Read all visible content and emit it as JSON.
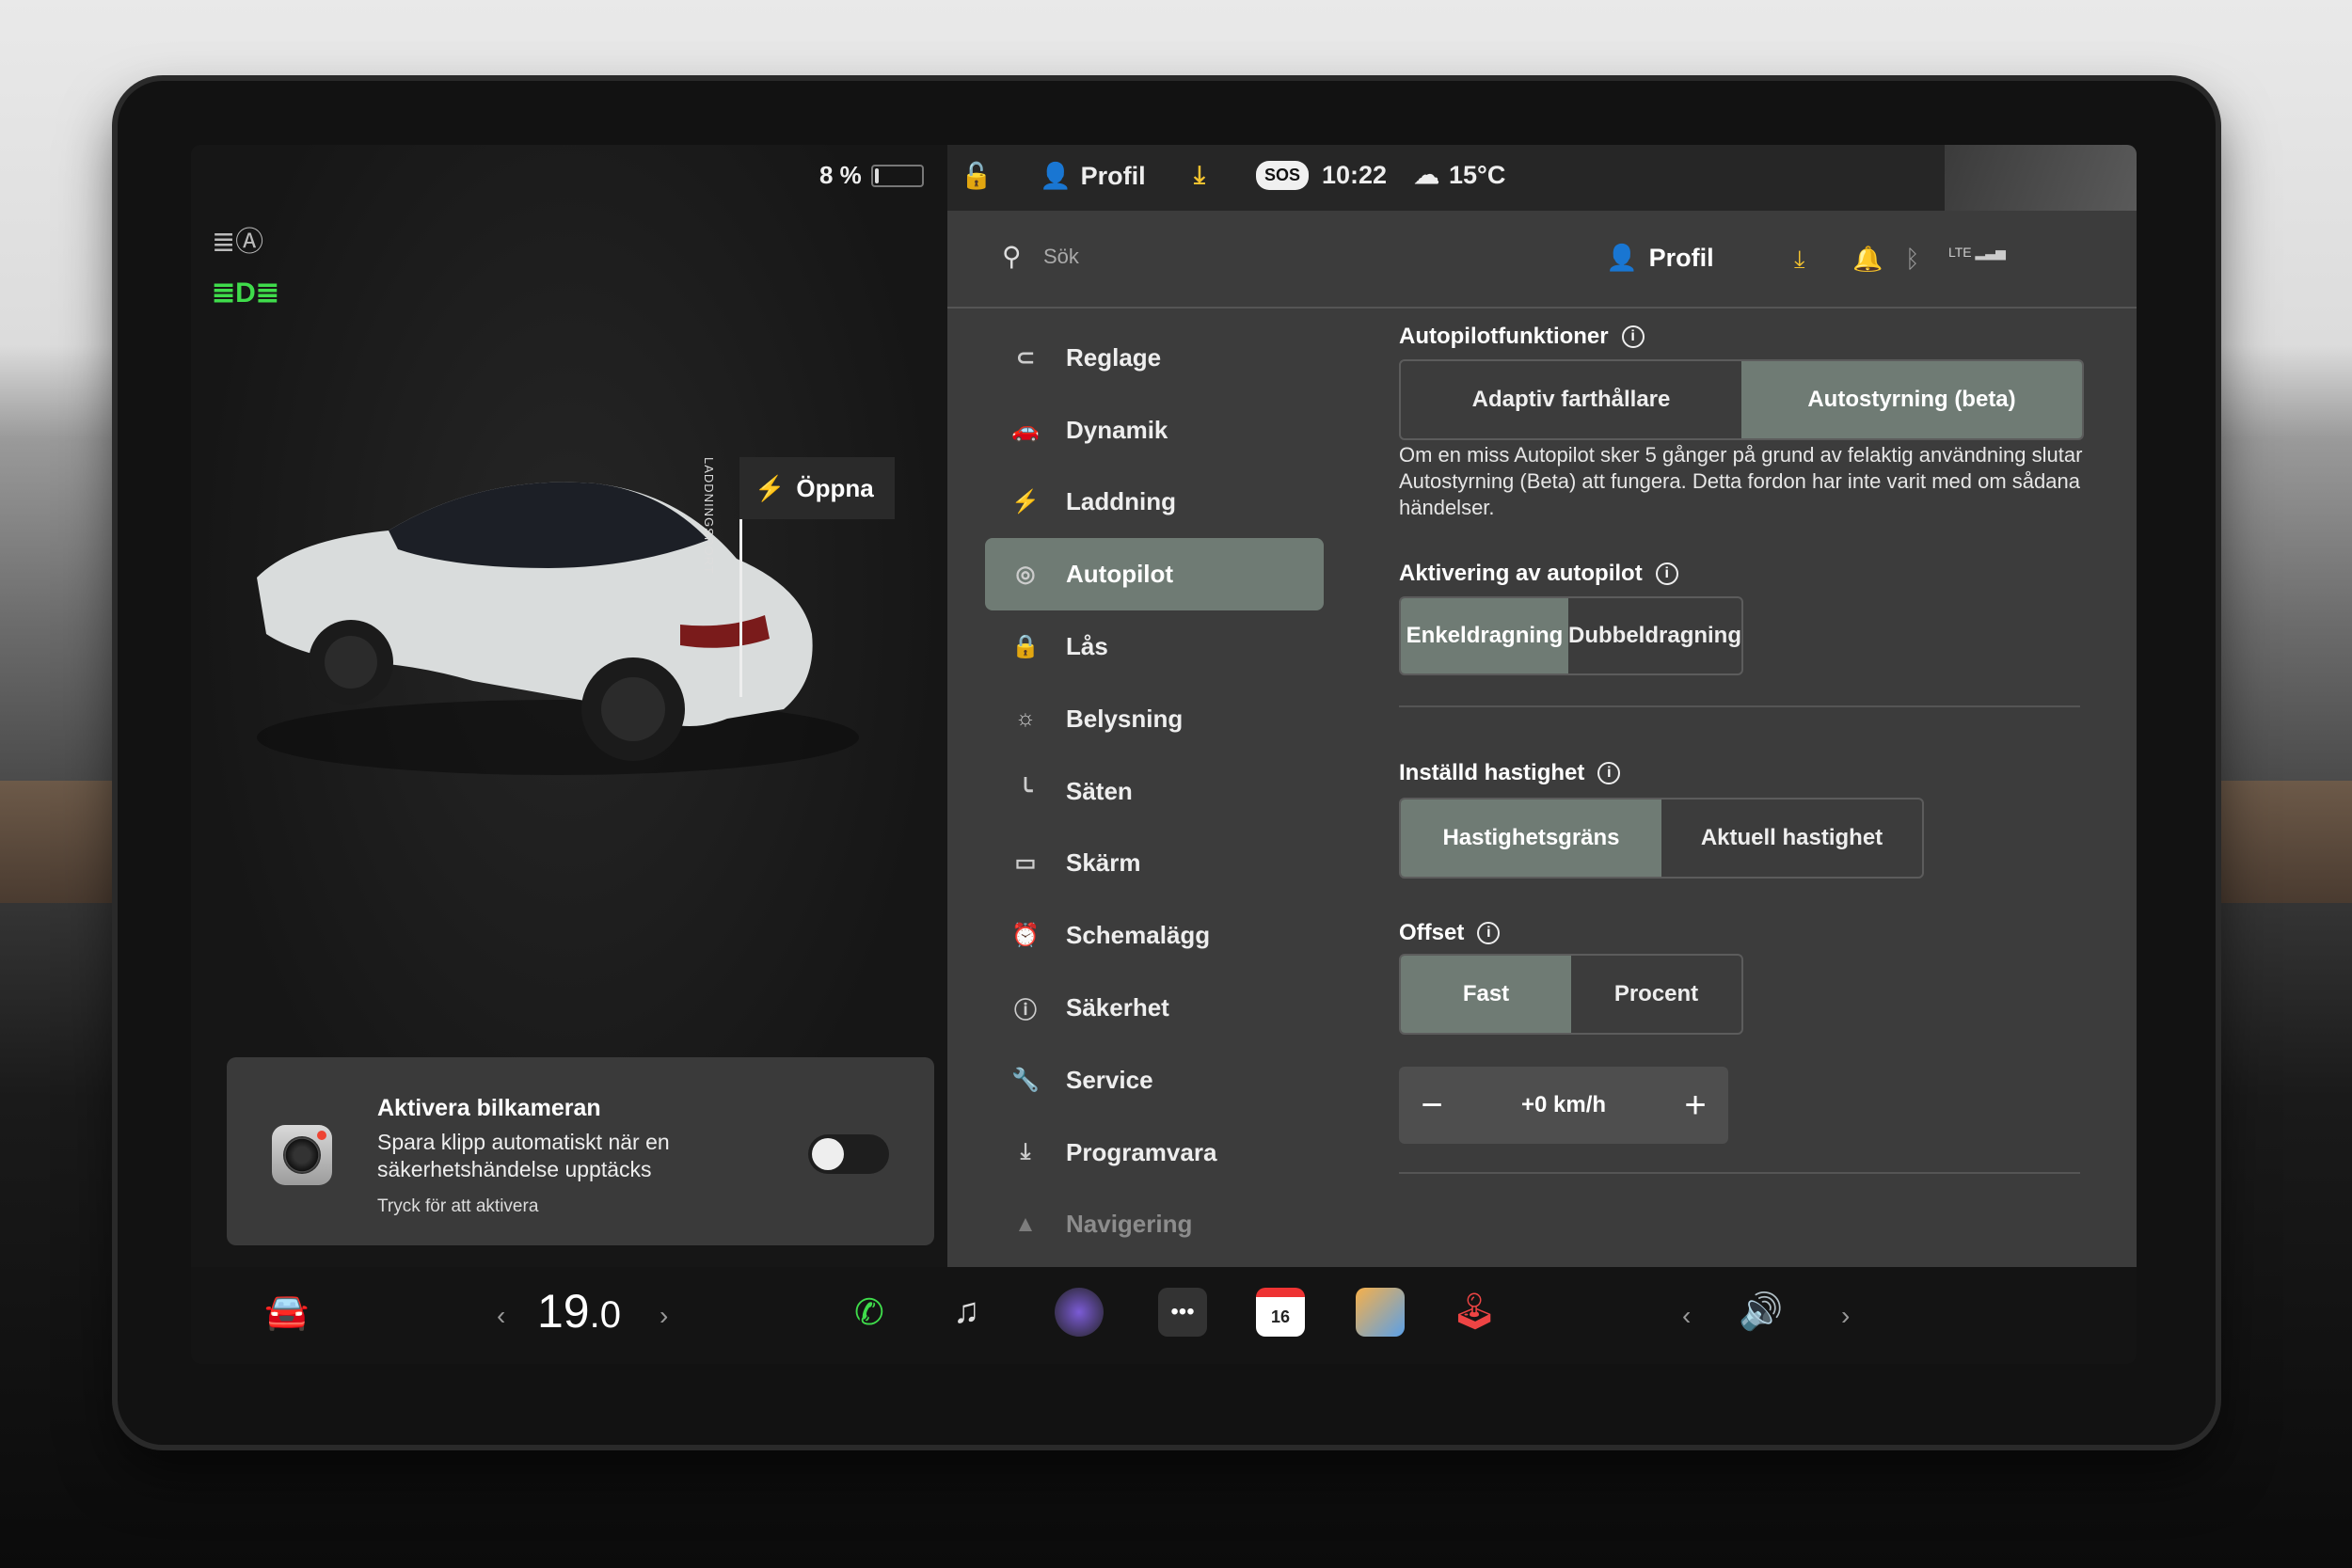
{
  "status": {
    "battery_pct_label": "8 %",
    "battery_level": 0.08,
    "profile": "Profil",
    "sos": "SOS",
    "time": "10:22",
    "temperature": "15°C"
  },
  "left": {
    "charge_port_label": "LADDNINGSPORT",
    "open_button": "Öppna",
    "camera_card": {
      "title": "Aktivera bilkameran",
      "description": "Spara klipp automatiskt när en säkerhetshändelse upptäcks",
      "hint": "Tryck för att aktivera",
      "enabled": false
    }
  },
  "topbar": {
    "search_placeholder": "Sök",
    "profile": "Profil",
    "network": "LTE"
  },
  "menu": [
    {
      "label": "Reglage",
      "icon": "toggle-icon"
    },
    {
      "label": "Dynamik",
      "icon": "car-icon"
    },
    {
      "label": "Laddning",
      "icon": "bolt-icon"
    },
    {
      "label": "Autopilot",
      "icon": "steering-wheel-icon"
    },
    {
      "label": "Lås",
      "icon": "lock-icon"
    },
    {
      "label": "Belysning",
      "icon": "sun-icon"
    },
    {
      "label": "Säten",
      "icon": "seat-icon"
    },
    {
      "label": "Skärm",
      "icon": "display-icon"
    },
    {
      "label": "Schemalägg",
      "icon": "alarm-clock-icon"
    },
    {
      "label": "Säkerhet",
      "icon": "info-icon"
    },
    {
      "label": "Service",
      "icon": "wrench-icon"
    },
    {
      "label": "Programvara",
      "icon": "download-icon"
    },
    {
      "label": "Navigering",
      "icon": "navigation-icon"
    }
  ],
  "active_menu": "Autopilot",
  "autopilot": {
    "features_title": "Autopilotfunktioner",
    "features_options": [
      "Adaptiv farthållare",
      "Autostyrning (beta)"
    ],
    "features_selected": 1,
    "features_note": "Om en miss Autopilot sker 5 gånger på grund av felaktig användning slutar Autostyrning (Beta) att fungera. Detta fordon har inte varit med om sådana händelser.",
    "activation_title": "Aktivering av autopilot",
    "activation_options": [
      "Enkeldragning",
      "Dubbeldragning"
    ],
    "activation_selected": 0,
    "speed_title": "Inställd hastighet",
    "speed_options": [
      "Hastighetsgräns",
      "Aktuell hastighet"
    ],
    "speed_selected": 0,
    "offset_title": "Offset",
    "offset_options": [
      "Fast",
      "Procent"
    ],
    "offset_selected": 0,
    "offset_value": "+0 km/h",
    "minus": "−",
    "plus": "+"
  },
  "dock": {
    "temp_main": "19",
    "temp_decimal": ".0",
    "calendar_day": "16",
    "left_arrow": "‹",
    "right_arrow": "›"
  },
  "colors": {
    "selected": "#6f7b74",
    "panel": "#3c3c3c",
    "headlight_green": "#3fdc4b",
    "download_yellow": "#f2c230"
  }
}
